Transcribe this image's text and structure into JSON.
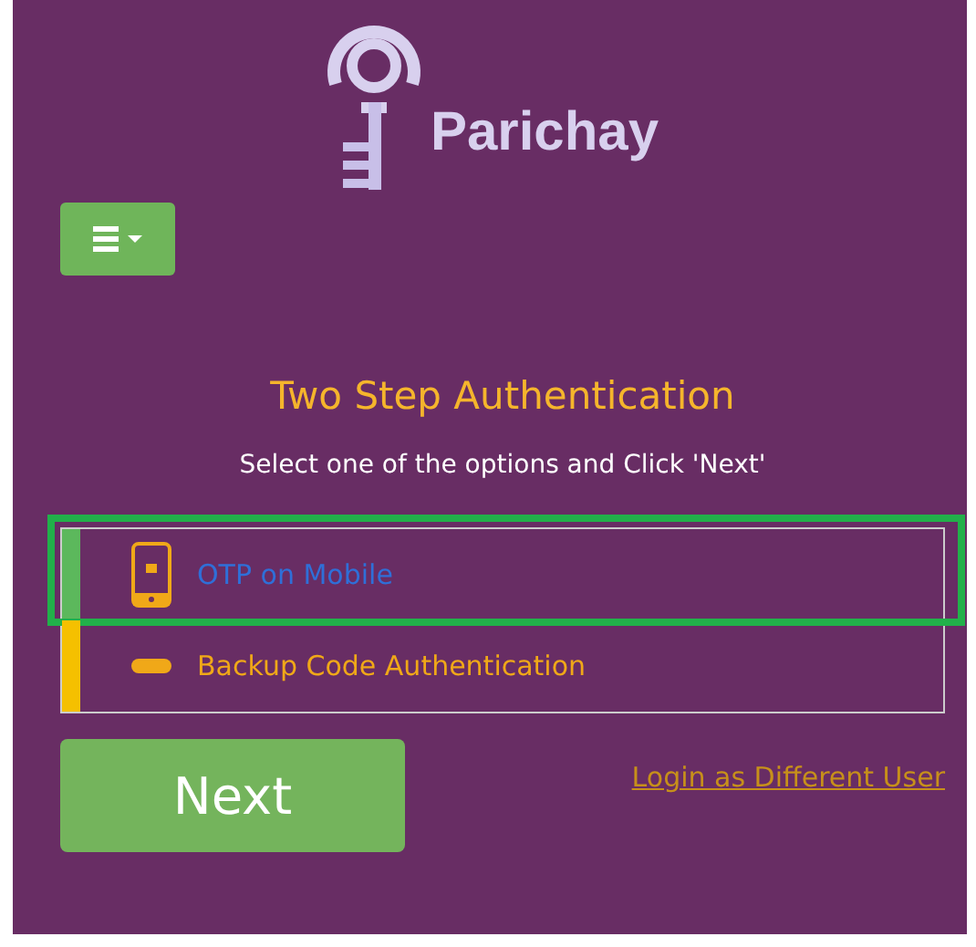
{
  "brand": {
    "name": "Parichay"
  },
  "heading": "Two Step Authentication",
  "instruction": "Select one of the options and Click 'Next'",
  "options": [
    {
      "kind": "mobile",
      "label": "OTP on Mobile",
      "selected": true
    },
    {
      "kind": "code",
      "label": "Backup Code Authentication",
      "selected": false
    }
  ],
  "next_button": "Next",
  "switch_user_link": "Login as Different User"
}
